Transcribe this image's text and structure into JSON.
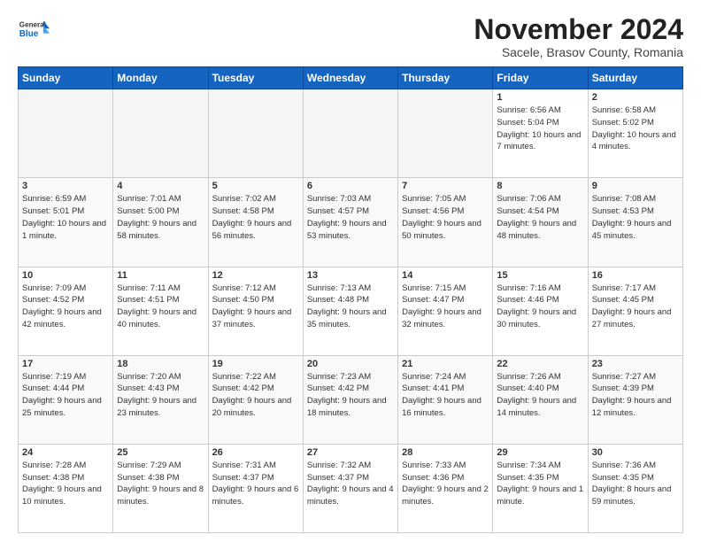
{
  "header": {
    "logo": {
      "general": "General",
      "blue": "Blue"
    },
    "month": "November 2024",
    "location": "Sacele, Brasov County, Romania"
  },
  "columns": [
    "Sunday",
    "Monday",
    "Tuesday",
    "Wednesday",
    "Thursday",
    "Friday",
    "Saturday"
  ],
  "weeks": [
    [
      {
        "day": "",
        "info": ""
      },
      {
        "day": "",
        "info": ""
      },
      {
        "day": "",
        "info": ""
      },
      {
        "day": "",
        "info": ""
      },
      {
        "day": "",
        "info": ""
      },
      {
        "day": "1",
        "info": "Sunrise: 6:56 AM\nSunset: 5:04 PM\nDaylight: 10 hours and 7 minutes."
      },
      {
        "day": "2",
        "info": "Sunrise: 6:58 AM\nSunset: 5:02 PM\nDaylight: 10 hours and 4 minutes."
      }
    ],
    [
      {
        "day": "3",
        "info": "Sunrise: 6:59 AM\nSunset: 5:01 PM\nDaylight: 10 hours and 1 minute."
      },
      {
        "day": "4",
        "info": "Sunrise: 7:01 AM\nSunset: 5:00 PM\nDaylight: 9 hours and 58 minutes."
      },
      {
        "day": "5",
        "info": "Sunrise: 7:02 AM\nSunset: 4:58 PM\nDaylight: 9 hours and 56 minutes."
      },
      {
        "day": "6",
        "info": "Sunrise: 7:03 AM\nSunset: 4:57 PM\nDaylight: 9 hours and 53 minutes."
      },
      {
        "day": "7",
        "info": "Sunrise: 7:05 AM\nSunset: 4:56 PM\nDaylight: 9 hours and 50 minutes."
      },
      {
        "day": "8",
        "info": "Sunrise: 7:06 AM\nSunset: 4:54 PM\nDaylight: 9 hours and 48 minutes."
      },
      {
        "day": "9",
        "info": "Sunrise: 7:08 AM\nSunset: 4:53 PM\nDaylight: 9 hours and 45 minutes."
      }
    ],
    [
      {
        "day": "10",
        "info": "Sunrise: 7:09 AM\nSunset: 4:52 PM\nDaylight: 9 hours and 42 minutes."
      },
      {
        "day": "11",
        "info": "Sunrise: 7:11 AM\nSunset: 4:51 PM\nDaylight: 9 hours and 40 minutes."
      },
      {
        "day": "12",
        "info": "Sunrise: 7:12 AM\nSunset: 4:50 PM\nDaylight: 9 hours and 37 minutes."
      },
      {
        "day": "13",
        "info": "Sunrise: 7:13 AM\nSunset: 4:48 PM\nDaylight: 9 hours and 35 minutes."
      },
      {
        "day": "14",
        "info": "Sunrise: 7:15 AM\nSunset: 4:47 PM\nDaylight: 9 hours and 32 minutes."
      },
      {
        "day": "15",
        "info": "Sunrise: 7:16 AM\nSunset: 4:46 PM\nDaylight: 9 hours and 30 minutes."
      },
      {
        "day": "16",
        "info": "Sunrise: 7:17 AM\nSunset: 4:45 PM\nDaylight: 9 hours and 27 minutes."
      }
    ],
    [
      {
        "day": "17",
        "info": "Sunrise: 7:19 AM\nSunset: 4:44 PM\nDaylight: 9 hours and 25 minutes."
      },
      {
        "day": "18",
        "info": "Sunrise: 7:20 AM\nSunset: 4:43 PM\nDaylight: 9 hours and 23 minutes."
      },
      {
        "day": "19",
        "info": "Sunrise: 7:22 AM\nSunset: 4:42 PM\nDaylight: 9 hours and 20 minutes."
      },
      {
        "day": "20",
        "info": "Sunrise: 7:23 AM\nSunset: 4:42 PM\nDaylight: 9 hours and 18 minutes."
      },
      {
        "day": "21",
        "info": "Sunrise: 7:24 AM\nSunset: 4:41 PM\nDaylight: 9 hours and 16 minutes."
      },
      {
        "day": "22",
        "info": "Sunrise: 7:26 AM\nSunset: 4:40 PM\nDaylight: 9 hours and 14 minutes."
      },
      {
        "day": "23",
        "info": "Sunrise: 7:27 AM\nSunset: 4:39 PM\nDaylight: 9 hours and 12 minutes."
      }
    ],
    [
      {
        "day": "24",
        "info": "Sunrise: 7:28 AM\nSunset: 4:38 PM\nDaylight: 9 hours and 10 minutes."
      },
      {
        "day": "25",
        "info": "Sunrise: 7:29 AM\nSunset: 4:38 PM\nDaylight: 9 hours and 8 minutes."
      },
      {
        "day": "26",
        "info": "Sunrise: 7:31 AM\nSunset: 4:37 PM\nDaylight: 9 hours and 6 minutes."
      },
      {
        "day": "27",
        "info": "Sunrise: 7:32 AM\nSunset: 4:37 PM\nDaylight: 9 hours and 4 minutes."
      },
      {
        "day": "28",
        "info": "Sunrise: 7:33 AM\nSunset: 4:36 PM\nDaylight: 9 hours and 2 minutes."
      },
      {
        "day": "29",
        "info": "Sunrise: 7:34 AM\nSunset: 4:35 PM\nDaylight: 9 hours and 1 minute."
      },
      {
        "day": "30",
        "info": "Sunrise: 7:36 AM\nSunset: 4:35 PM\nDaylight: 8 hours and 59 minutes."
      }
    ]
  ],
  "emptyDays": [
    0,
    1,
    2,
    3,
    4
  ]
}
